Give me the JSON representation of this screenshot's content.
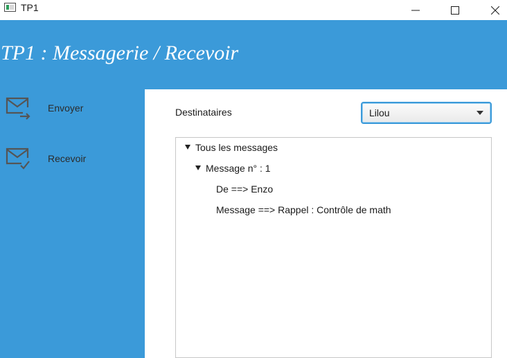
{
  "window": {
    "title": "TP1",
    "minimize_icon": "minimize-icon",
    "maximize_icon": "maximize-icon",
    "close_icon": "close-icon"
  },
  "header": {
    "title": "TP1 : Messagerie / Recevoir"
  },
  "sidebar": {
    "items": [
      {
        "label": "Envoyer",
        "icon": "mail-send-icon"
      },
      {
        "label": "Recevoir",
        "icon": "mail-received-icon"
      }
    ]
  },
  "main": {
    "recipients_label": "Destinataires",
    "recipient_select": {
      "value": "Lilou"
    },
    "tree": {
      "root": {
        "label": "Tous les messages",
        "expanded": true
      },
      "message": {
        "label": "Message n° : 1",
        "expanded": true
      },
      "from": "De ==> Enzo",
      "body": "Message ==> Rappel : Contrôle de math"
    }
  },
  "colors": {
    "accent": "#3b9ad9",
    "text": "#1a1a1a"
  }
}
